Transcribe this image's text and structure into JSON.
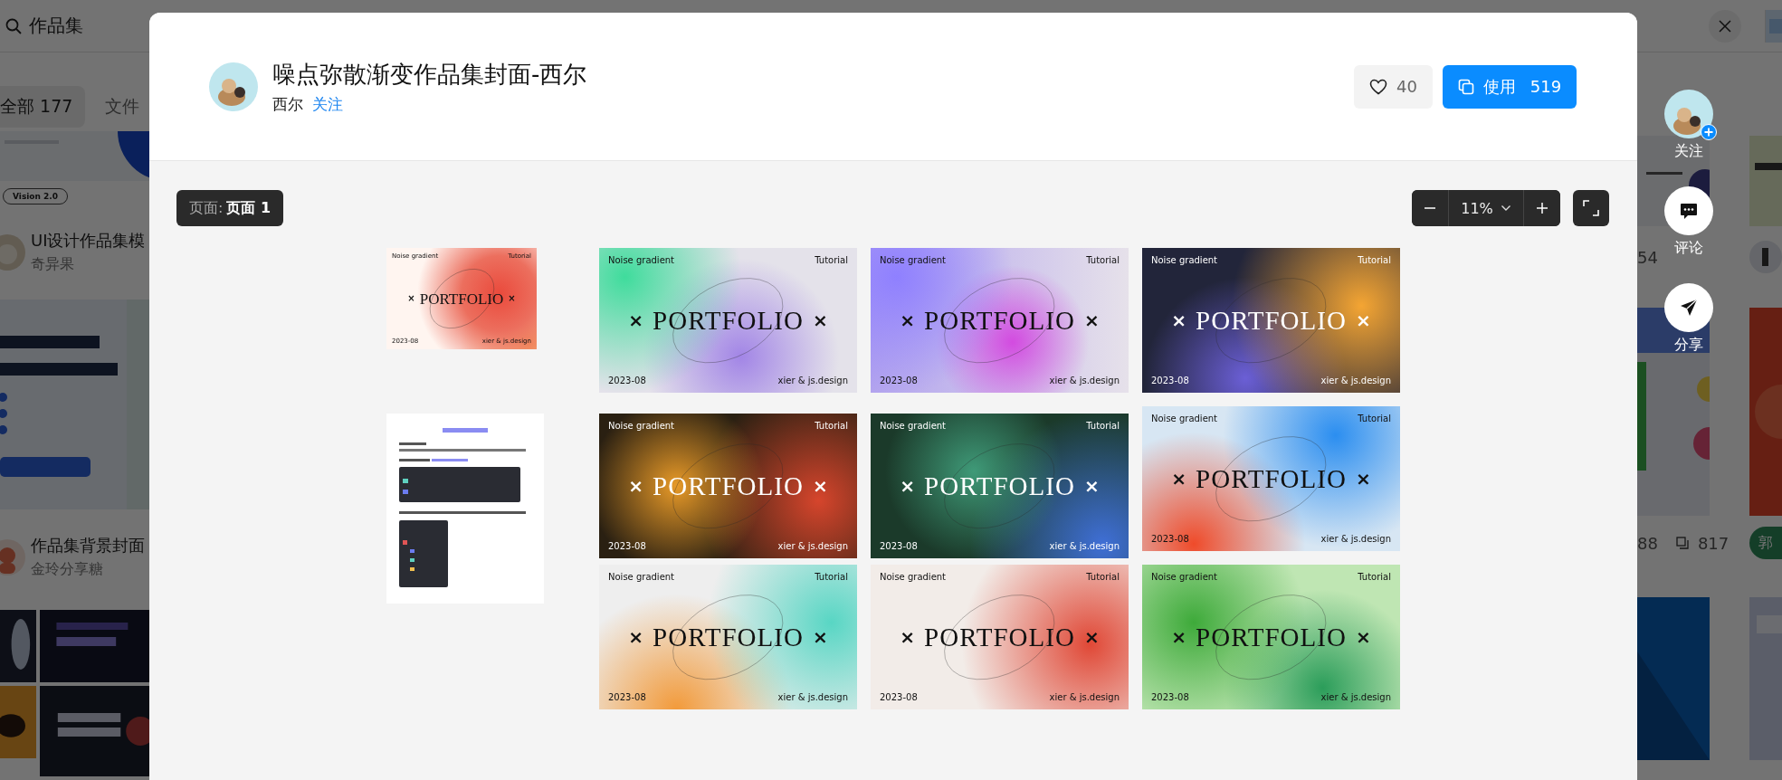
{
  "background_page": {
    "search": {
      "value": "作品集"
    },
    "tabs": [
      {
        "label": "全部",
        "count": "177",
        "selected": true
      },
      {
        "label": "文件",
        "selected": false
      }
    ],
    "badge": "Vision 2.0",
    "works": [
      {
        "title": "UI设计作品集模",
        "author": "奇异果"
      },
      {
        "title": "作品集背景封面",
        "author": "金玲分享糖"
      }
    ],
    "right_stats": [
      {
        "likes": "54"
      },
      {
        "likes": "88",
        "uses": "817"
      }
    ],
    "right_avatar_initial": "郭"
  },
  "modal": {
    "title": "噪点弥散渐变作品集封面-西尔",
    "author": "西尔",
    "follow": "关注",
    "like_count": "40",
    "use_label": "使用",
    "use_count": "519",
    "page_label": "页面:",
    "page_name": "页面 1",
    "zoom": "11%",
    "frames": [
      {
        "kind": "cover",
        "dark": false,
        "tag": "Noise gradient",
        "label": "Tutorial",
        "mark_left": "×",
        "title": "PORTFOLIO",
        "mark_right": "×",
        "date": "2023-08",
        "credit": "xier & js.design"
      },
      {
        "kind": "document"
      },
      {
        "kind": "cover",
        "dark": false,
        "tag": "Noise gradient",
        "label": "Tutorial",
        "mark_left": "×",
        "title": "PORTFOLIO",
        "mark_right": "×",
        "date": "2023-08",
        "credit": "xier & js.design"
      },
      {
        "kind": "cover",
        "dark": false,
        "tag": "Noise gradient",
        "label": "Tutorial",
        "mark_left": "×",
        "title": "PORTFOLIO",
        "mark_right": "×",
        "date": "2023-08",
        "credit": "xier & js.design"
      },
      {
        "kind": "cover",
        "dark": true,
        "tag": "Noise gradient",
        "label": "Tutorial",
        "mark_left": "×",
        "title": "PORTFOLIO",
        "mark_right": "×",
        "date": "2023-08",
        "credit": "xier & js.design"
      },
      {
        "kind": "cover",
        "dark": true,
        "tag": "Noise gradient",
        "label": "Tutorial",
        "mark_left": "×",
        "title": "PORTFOLIO",
        "mark_right": "×",
        "date": "2023-08",
        "credit": "xier & js.design"
      },
      {
        "kind": "cover",
        "dark": true,
        "tag": "Noise gradient",
        "label": "Tutorial",
        "mark_left": "×",
        "title": "PORTFOLIO",
        "mark_right": "×",
        "date": "2023-08",
        "credit": "xier & js.design"
      },
      {
        "kind": "cover",
        "dark": false,
        "tag": "Noise gradient",
        "label": "Tutorial",
        "mark_left": "×",
        "title": "PORTFOLIO",
        "mark_right": "×",
        "date": "2023-08",
        "credit": "xier & js.design"
      },
      {
        "kind": "cover",
        "dark": false,
        "tag": "Noise gradient",
        "label": "Tutorial",
        "mark_left": "×",
        "title": "PORTFOLIO",
        "mark_right": "×",
        "date": "2023-08",
        "credit": "xier & js.design"
      },
      {
        "kind": "cover",
        "dark": false,
        "tag": "Noise gradient",
        "label": "Tutorial",
        "mark_left": "×",
        "title": "PORTFOLIO",
        "mark_right": "×",
        "date": "2023-08",
        "credit": "xier & js.design"
      },
      {
        "kind": "cover",
        "dark": false,
        "tag": "Noise gradient",
        "label": "Tutorial",
        "mark_left": "×",
        "title": "PORTFOLIO",
        "mark_right": "×",
        "date": "2023-08",
        "credit": "xier & js.design"
      }
    ]
  },
  "side_actions": [
    {
      "kind": "follow",
      "label": "关注"
    },
    {
      "kind": "comment",
      "label": "评论"
    },
    {
      "kind": "share",
      "label": "分享"
    }
  ]
}
